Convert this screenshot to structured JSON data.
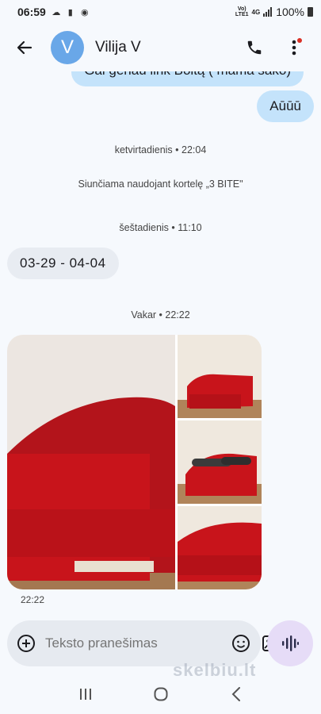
{
  "status": {
    "time": "06:59",
    "network_top": "Vo)",
    "network_bottom": "LTE1",
    "network_type": "4G",
    "battery": "100%"
  },
  "header": {
    "avatar_letter": "V",
    "contact_name": "Vilija V"
  },
  "messages": {
    "out_1": "Gal genau link Boltą ( mama sako)",
    "out_2": "Aūūū",
    "date_1": "ketvirtadienis • 22:04",
    "sim_notice": "Siunčiama naudojant kortelę „3 BITE\"",
    "date_2": "šeštadienis • 11:10",
    "in_1": "03-29 - 04-04",
    "date_3": "Vakar • 22:22",
    "photos_time": "22:22"
  },
  "composer": {
    "placeholder": "Teksto pranešimas"
  },
  "watermark": "skelbiu.lt",
  "colors": {
    "accent": "#69a7e8",
    "outgoing": "#c4e3fb",
    "incoming": "#e8ecf2",
    "sofa_red": "#c8141b",
    "voice": "#e6dcf7"
  }
}
